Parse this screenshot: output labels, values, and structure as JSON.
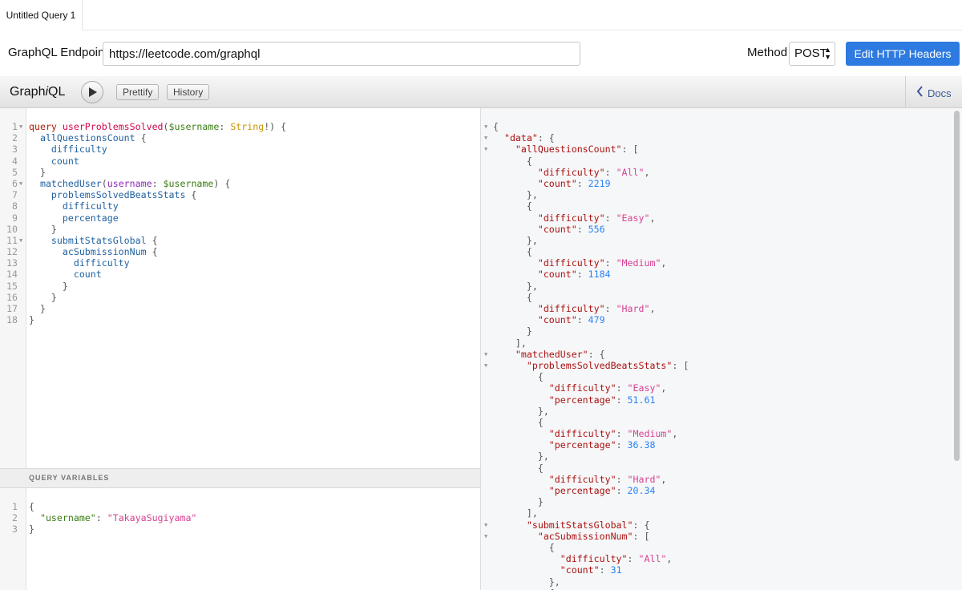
{
  "tab": {
    "label": "Untitled Query 1"
  },
  "endpoint": {
    "label": "GraphQL Endpoint",
    "value": "https://leetcode.com/graphql"
  },
  "method": {
    "label": "Method",
    "value": "POST"
  },
  "headers_button": {
    "label": "Edit HTTP Headers"
  },
  "toolbar": {
    "logo_pre": "Graph",
    "logo_i": "i",
    "logo_post": "QL",
    "prettify": "Prettify",
    "history": "History",
    "docs": "Docs"
  },
  "query_editor": {
    "lines": [
      {
        "n": "1",
        "fold": true,
        "tokens": [
          [
            "kw",
            "query "
          ],
          [
            "def",
            "userProblemsSolved"
          ],
          [
            "punc",
            "("
          ],
          [
            "var",
            "$username"
          ],
          [
            "punc",
            ": "
          ],
          [
            "type",
            "String"
          ],
          [
            "punc",
            "!) {"
          ]
        ]
      },
      {
        "n": "2",
        "tokens": [
          [
            "prop",
            "  allQuestionsCount"
          ],
          [
            "punc",
            " {"
          ]
        ]
      },
      {
        "n": "3",
        "tokens": [
          [
            "prop",
            "    difficulty"
          ]
        ]
      },
      {
        "n": "4",
        "tokens": [
          [
            "prop",
            "    count"
          ]
        ]
      },
      {
        "n": "5",
        "tokens": [
          [
            "punc",
            "  }"
          ]
        ]
      },
      {
        "n": "6",
        "fold": true,
        "tokens": [
          [
            "prop",
            "  matchedUser"
          ],
          [
            "punc",
            "("
          ],
          [
            "attr",
            "username"
          ],
          [
            "punc",
            ": "
          ],
          [
            "var",
            "$username"
          ],
          [
            "punc",
            ") {"
          ]
        ]
      },
      {
        "n": "7",
        "tokens": [
          [
            "prop",
            "    problemsSolvedBeatsStats"
          ],
          [
            "punc",
            " {"
          ]
        ]
      },
      {
        "n": "8",
        "tokens": [
          [
            "prop",
            "      difficulty"
          ]
        ]
      },
      {
        "n": "9",
        "tokens": [
          [
            "prop",
            "      percentage"
          ]
        ]
      },
      {
        "n": "10",
        "tokens": [
          [
            "punc",
            "    }"
          ]
        ]
      },
      {
        "n": "11",
        "fold": true,
        "tokens": [
          [
            "prop",
            "    submitStatsGlobal"
          ],
          [
            "punc",
            " {"
          ]
        ]
      },
      {
        "n": "12",
        "tokens": [
          [
            "prop",
            "      acSubmissionNum"
          ],
          [
            "punc",
            " {"
          ]
        ]
      },
      {
        "n": "13",
        "tokens": [
          [
            "prop",
            "        difficulty"
          ]
        ]
      },
      {
        "n": "14",
        "tokens": [
          [
            "prop",
            "        count"
          ]
        ]
      },
      {
        "n": "15",
        "tokens": [
          [
            "punc",
            "      }"
          ]
        ]
      },
      {
        "n": "16",
        "tokens": [
          [
            "punc",
            "    }"
          ]
        ]
      },
      {
        "n": "17",
        "tokens": [
          [
            "punc",
            "  }"
          ]
        ]
      },
      {
        "n": "18",
        "tokens": [
          [
            "punc",
            "}"
          ]
        ]
      }
    ]
  },
  "variables": {
    "header": "QUERY VARIABLES",
    "lines": [
      {
        "n": "1",
        "tokens": [
          [
            "punc",
            "{"
          ]
        ]
      },
      {
        "n": "2",
        "tokens": [
          [
            "var",
            "  \"username\""
          ],
          [
            "punc",
            ": "
          ],
          [
            "str",
            "\"TakayaSugiyama\""
          ]
        ]
      },
      {
        "n": "3",
        "tokens": [
          [
            "punc",
            "}"
          ]
        ]
      }
    ]
  },
  "result": {
    "lines": [
      {
        "fold": true,
        "tokens": [
          [
            "punc",
            "{"
          ]
        ]
      },
      {
        "fold": true,
        "tokens": [
          [
            "jkey",
            "  \"data\""
          ],
          [
            "punc",
            ": {"
          ]
        ]
      },
      {
        "fold": true,
        "tokens": [
          [
            "jkey",
            "    \"allQuestionsCount\""
          ],
          [
            "punc",
            ": ["
          ]
        ]
      },
      {
        "tokens": [
          [
            "punc",
            "      {"
          ]
        ]
      },
      {
        "tokens": [
          [
            "jkey",
            "        \"difficulty\""
          ],
          [
            "punc",
            ": "
          ],
          [
            "str",
            "\"All\""
          ],
          [
            "punc",
            ","
          ]
        ]
      },
      {
        "tokens": [
          [
            "jkey",
            "        \"count\""
          ],
          [
            "punc",
            ": "
          ],
          [
            "num",
            "2219"
          ]
        ]
      },
      {
        "tokens": [
          [
            "punc",
            "      },"
          ]
        ]
      },
      {
        "tokens": [
          [
            "punc",
            "      {"
          ]
        ]
      },
      {
        "tokens": [
          [
            "jkey",
            "        \"difficulty\""
          ],
          [
            "punc",
            ": "
          ],
          [
            "str",
            "\"Easy\""
          ],
          [
            "punc",
            ","
          ]
        ]
      },
      {
        "tokens": [
          [
            "jkey",
            "        \"count\""
          ],
          [
            "punc",
            ": "
          ],
          [
            "num",
            "556"
          ]
        ]
      },
      {
        "tokens": [
          [
            "punc",
            "      },"
          ]
        ]
      },
      {
        "tokens": [
          [
            "punc",
            "      {"
          ]
        ]
      },
      {
        "tokens": [
          [
            "jkey",
            "        \"difficulty\""
          ],
          [
            "punc",
            ": "
          ],
          [
            "str",
            "\"Medium\""
          ],
          [
            "punc",
            ","
          ]
        ]
      },
      {
        "tokens": [
          [
            "jkey",
            "        \"count\""
          ],
          [
            "punc",
            ": "
          ],
          [
            "num",
            "1184"
          ]
        ]
      },
      {
        "tokens": [
          [
            "punc",
            "      },"
          ]
        ]
      },
      {
        "tokens": [
          [
            "punc",
            "      {"
          ]
        ]
      },
      {
        "tokens": [
          [
            "jkey",
            "        \"difficulty\""
          ],
          [
            "punc",
            ": "
          ],
          [
            "str",
            "\"Hard\""
          ],
          [
            "punc",
            ","
          ]
        ]
      },
      {
        "tokens": [
          [
            "jkey",
            "        \"count\""
          ],
          [
            "punc",
            ": "
          ],
          [
            "num",
            "479"
          ]
        ]
      },
      {
        "tokens": [
          [
            "punc",
            "      }"
          ]
        ]
      },
      {
        "tokens": [
          [
            "punc",
            "    ],"
          ]
        ]
      },
      {
        "fold": true,
        "tokens": [
          [
            "jkey",
            "    \"matchedUser\""
          ],
          [
            "punc",
            ": {"
          ]
        ]
      },
      {
        "fold": true,
        "tokens": [
          [
            "jkey",
            "      \"problemsSolvedBeatsStats\""
          ],
          [
            "punc",
            ": ["
          ]
        ]
      },
      {
        "tokens": [
          [
            "punc",
            "        {"
          ]
        ]
      },
      {
        "tokens": [
          [
            "jkey",
            "          \"difficulty\""
          ],
          [
            "punc",
            ": "
          ],
          [
            "str",
            "\"Easy\""
          ],
          [
            "punc",
            ","
          ]
        ]
      },
      {
        "tokens": [
          [
            "jkey",
            "          \"percentage\""
          ],
          [
            "punc",
            ": "
          ],
          [
            "num",
            "51.61"
          ]
        ]
      },
      {
        "tokens": [
          [
            "punc",
            "        },"
          ]
        ]
      },
      {
        "tokens": [
          [
            "punc",
            "        {"
          ]
        ]
      },
      {
        "tokens": [
          [
            "jkey",
            "          \"difficulty\""
          ],
          [
            "punc",
            ": "
          ],
          [
            "str",
            "\"Medium\""
          ],
          [
            "punc",
            ","
          ]
        ]
      },
      {
        "tokens": [
          [
            "jkey",
            "          \"percentage\""
          ],
          [
            "punc",
            ": "
          ],
          [
            "num",
            "36.38"
          ]
        ]
      },
      {
        "tokens": [
          [
            "punc",
            "        },"
          ]
        ]
      },
      {
        "tokens": [
          [
            "punc",
            "        {"
          ]
        ]
      },
      {
        "tokens": [
          [
            "jkey",
            "          \"difficulty\""
          ],
          [
            "punc",
            ": "
          ],
          [
            "str",
            "\"Hard\""
          ],
          [
            "punc",
            ","
          ]
        ]
      },
      {
        "tokens": [
          [
            "jkey",
            "          \"percentage\""
          ],
          [
            "punc",
            ": "
          ],
          [
            "num",
            "20.34"
          ]
        ]
      },
      {
        "tokens": [
          [
            "punc",
            "        }"
          ]
        ]
      },
      {
        "tokens": [
          [
            "punc",
            "      ],"
          ]
        ]
      },
      {
        "fold": true,
        "tokens": [
          [
            "jkey",
            "      \"submitStatsGlobal\""
          ],
          [
            "punc",
            ": {"
          ]
        ]
      },
      {
        "fold": true,
        "tokens": [
          [
            "jkey",
            "        \"acSubmissionNum\""
          ],
          [
            "punc",
            ": ["
          ]
        ]
      },
      {
        "tokens": [
          [
            "punc",
            "          {"
          ]
        ]
      },
      {
        "tokens": [
          [
            "jkey",
            "            \"difficulty\""
          ],
          [
            "punc",
            ": "
          ],
          [
            "str",
            "\"All\""
          ],
          [
            "punc",
            ","
          ]
        ]
      },
      {
        "tokens": [
          [
            "jkey",
            "            \"count\""
          ],
          [
            "punc",
            ": "
          ],
          [
            "num",
            "31"
          ]
        ]
      },
      {
        "tokens": [
          [
            "punc",
            "          },"
          ]
        ]
      },
      {
        "tokens": [
          [
            "punc",
            "          {"
          ]
        ]
      }
    ]
  },
  "colors": {
    "accent": "#2d7ae0",
    "docs_link": "#3b5998"
  },
  "icons": {
    "run": "play-icon",
    "docs": "chevron-left-icon",
    "select": "up-down-arrows-icon"
  }
}
